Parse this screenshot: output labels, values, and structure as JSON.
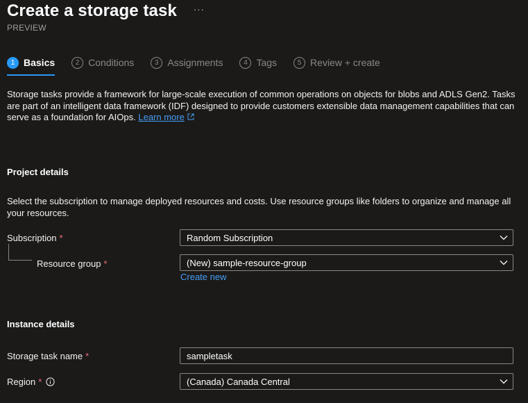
{
  "header": {
    "title": "Create a storage task",
    "more": "···",
    "subtitle": "PREVIEW"
  },
  "tabs": [
    {
      "num": "1",
      "label": "Basics",
      "active": true
    },
    {
      "num": "2",
      "label": "Conditions",
      "active": false
    },
    {
      "num": "3",
      "label": "Assignments",
      "active": false
    },
    {
      "num": "4",
      "label": "Tags",
      "active": false
    },
    {
      "num": "5",
      "label": "Review + create",
      "active": false
    }
  ],
  "intro": {
    "text": "Storage tasks provide a framework for large-scale execution of common operations on objects for blobs and ADLS Gen2. Tasks are part of an intelligent data framework (IDF) designed to provide customers extensible data management capabilities that can serve as a foundation for AIOps.",
    "link": "Learn more"
  },
  "project": {
    "title": "Project details",
    "description": "Select the subscription to manage deployed resources and costs. Use resource groups like folders to organize and manage all your resources.",
    "subscription_label": "Subscription",
    "subscription_value": "Random Subscription",
    "resource_group_label": "Resource group",
    "resource_group_value": "(New) sample-resource-group",
    "create_new": "Create new"
  },
  "instance": {
    "title": "Instance details",
    "name_label": "Storage task name",
    "name_value": "sampletask",
    "region_label": "Region",
    "region_value": "(Canada) Canada Central"
  },
  "required_mark": "*",
  "colors": {
    "background": "#1b1a19",
    "accent": "#2899f5",
    "link": "#479ef5",
    "required": "#f1707b"
  },
  "icons": [
    "ellipsis-icon",
    "external-link-icon",
    "info-icon",
    "chevron-down-icon"
  ]
}
